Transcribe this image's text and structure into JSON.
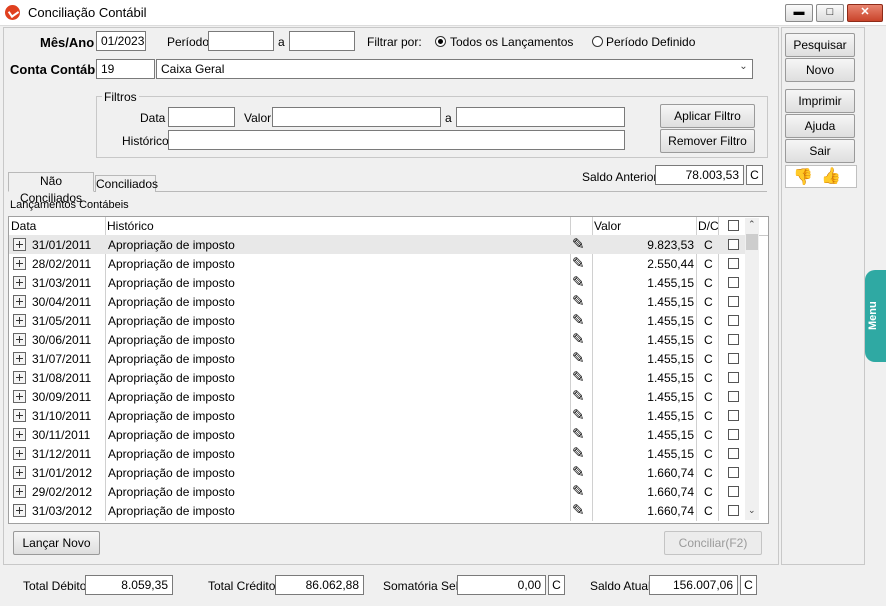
{
  "window": {
    "title": "Conciliação Contábil"
  },
  "header": {
    "mes_ano_label": "Mês/Ano",
    "mes_ano": "01/2023",
    "periodo_label": "Período",
    "periodo_de": "",
    "a_label": "a",
    "periodo_ate": "",
    "filtrar_por_label": "Filtrar por:",
    "opt_todos": "Todos os Lançamentos",
    "opt_periodo": "Período Definido",
    "conta_label": "Conta Contábil",
    "conta_codigo": "19",
    "conta_nome": "Caixa Geral"
  },
  "filtros": {
    "legend": "Filtros",
    "data_label": "Data",
    "data": "",
    "valor_label": "Valor",
    "valor_de": "",
    "a_label": "a",
    "valor_ate": "",
    "historico_label": "Histórico",
    "historico": "",
    "aplicar_label": "Aplicar Filtro",
    "remover_label": "Remover Filtro"
  },
  "side_buttons": {
    "pesquisar": "Pesquisar",
    "novo": "Novo",
    "imprimir": "Imprimir",
    "ajuda": "Ajuda",
    "sair": "Sair"
  },
  "tabs": [
    "Não Conciliados",
    "Conciliados"
  ],
  "saldo_anterior": {
    "label": "Saldo Anterior",
    "value": "78.003,53",
    "dc": "C"
  },
  "grid": {
    "caption": "Lançamentos Contábeis",
    "columns": [
      "Data",
      "Histórico",
      "Valor",
      "D/C"
    ],
    "rows": [
      {
        "data": "31/01/2011",
        "historico": "Apropriação de imposto",
        "valor": "9.823,53",
        "dc": "C"
      },
      {
        "data": "28/02/2011",
        "historico": "Apropriação de imposto",
        "valor": "2.550,44",
        "dc": "C"
      },
      {
        "data": "31/03/2011",
        "historico": "Apropriação de imposto",
        "valor": "1.455,15",
        "dc": "C"
      },
      {
        "data": "30/04/2011",
        "historico": "Apropriação de imposto",
        "valor": "1.455,15",
        "dc": "C"
      },
      {
        "data": "31/05/2011",
        "historico": "Apropriação de imposto",
        "valor": "1.455,15",
        "dc": "C"
      },
      {
        "data": "30/06/2011",
        "historico": "Apropriação de imposto",
        "valor": "1.455,15",
        "dc": "C"
      },
      {
        "data": "31/07/2011",
        "historico": "Apropriação de imposto",
        "valor": "1.455,15",
        "dc": "C"
      },
      {
        "data": "31/08/2011",
        "historico": "Apropriação de imposto",
        "valor": "1.455,15",
        "dc": "C"
      },
      {
        "data": "30/09/2011",
        "historico": "Apropriação de imposto",
        "valor": "1.455,15",
        "dc": "C"
      },
      {
        "data": "31/10/2011",
        "historico": "Apropriação de imposto",
        "valor": "1.455,15",
        "dc": "C"
      },
      {
        "data": "30/11/2011",
        "historico": "Apropriação de imposto",
        "valor": "1.455,15",
        "dc": "C"
      },
      {
        "data": "31/12/2011",
        "historico": "Apropriação de imposto",
        "valor": "1.455,15",
        "dc": "C"
      },
      {
        "data": "31/01/2012",
        "historico": "Apropriação de imposto",
        "valor": "1.660,74",
        "dc": "C"
      },
      {
        "data": "29/02/2012",
        "historico": "Apropriação de imposto",
        "valor": "1.660,74",
        "dc": "C"
      },
      {
        "data": "31/03/2012",
        "historico": "Apropriação de imposto",
        "valor": "1.660,74",
        "dc": "C"
      }
    ]
  },
  "bottom": {
    "lancar_novo": "Lançar Novo",
    "conciliar": "Conciliar(F2)"
  },
  "totals": {
    "debito_label": "Total Débito",
    "debito": "8.059,35",
    "credito_label": "Total Crédito",
    "credito": "86.062,88",
    "somatoria_label": "Somatória Sel.",
    "somatoria": "0,00",
    "somatoria_dc": "C",
    "saldo_label": "Saldo Atual",
    "saldo": "156.007,06",
    "saldo_dc": "C"
  },
  "side_menu": {
    "label": "Menu"
  },
  "icons": [
    "app-icon",
    "minimize-icon",
    "maximize-icon",
    "close-icon",
    "dropdown-icon",
    "thumbs-down-icon",
    "thumbs-up-icon",
    "expand-icon",
    "edit-icon",
    "scroll-up-icon",
    "scroll-down-icon"
  ]
}
